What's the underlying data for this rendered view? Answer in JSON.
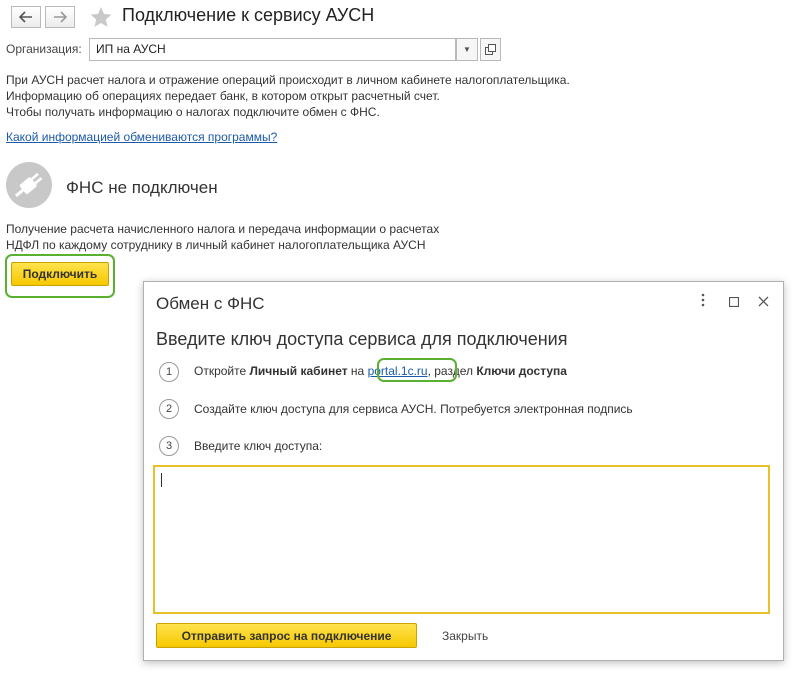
{
  "header": {
    "title": "Подключение к сервису АУСН",
    "back_icon": "arrow-left-icon",
    "forward_icon": "arrow-right-icon",
    "favorite_icon": "star-icon"
  },
  "organization": {
    "label": "Организация:",
    "value": "ИП на АУСН"
  },
  "info": {
    "line1": "При АУСН расчет налога и отражение операций происходит в личном кабинете налогоплательщика.",
    "line2": "Информацию об операциях передает банк, в котором открыт расчетный счет.",
    "line3": "Чтобы получать информацию о налогах подключите обмен с ФНС.",
    "link": "Какой информацией обмениваются программы?"
  },
  "fns": {
    "status": "ФНС не подключен",
    "icon": "plug-icon",
    "desc_line1": "Получение расчета начисленного налога и передача информации о расчетах",
    "desc_line2": "НДФЛ по каждому сотруднику в личный кабинет налогоплательщика АУСН",
    "connect_label": "Подключить"
  },
  "dialog": {
    "title": "Обмен с ФНС",
    "heading": "Введите ключ доступа сервиса для подключения",
    "steps": [
      {
        "num": "1",
        "pre": "Откройте ",
        "bold1": "Личный кабинет",
        "mid": " на ",
        "link": "portal.1c.ru",
        "post": ", раздел ",
        "bold2": "Ключи доступа"
      },
      {
        "num": "2",
        "text": "Создайте ключ доступа для сервиса АУСН. Потребуется электронная подпись"
      },
      {
        "num": "3",
        "text": "Введите ключ доступа:"
      }
    ],
    "key_value": "",
    "send_label": "Отправить запрос на подключение",
    "close_label": "Закрыть"
  },
  "colors": {
    "accent_yellow": "#f6c800",
    "highlight_green": "#5ab031",
    "link_blue": "#1c5aa8",
    "input_border_yellow": "#e6c228"
  }
}
